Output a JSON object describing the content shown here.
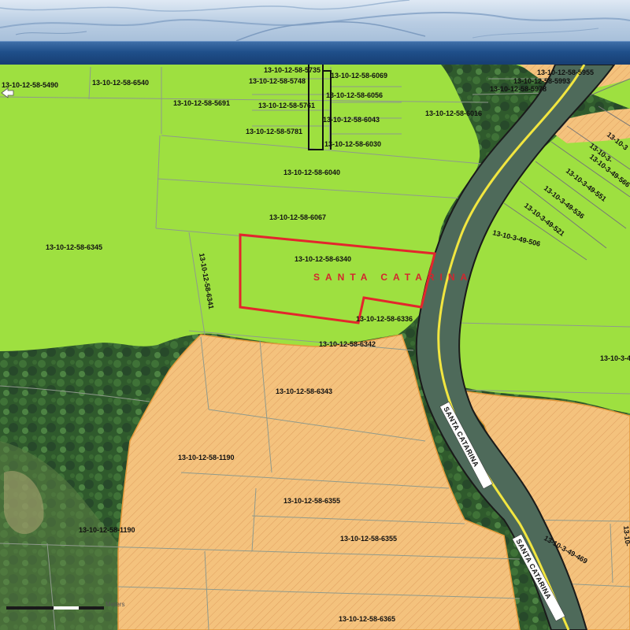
{
  "map": {
    "place_name": "SANTA CATARINA",
    "road_labels": [
      "SANTA CATARINA",
      "SANTA CATARINA"
    ],
    "scale_bar": {
      "unit_label": "Meters"
    },
    "colors": {
      "urban_zone": "#9ee040",
      "orange_zone": "#f4c27d",
      "orange_hatch": "#e0a060",
      "highlight_parcel": "#e3262c",
      "road_centerline": "#f2e640",
      "toolbar": "#1f4f8a"
    },
    "highlighted_parcel": "13-10-12-58-6340",
    "parcels": [
      "13-10-12-58-5490",
      "13-10-12-58-6540",
      "13-10-12-58-5735",
      "13-10-12-58-5748",
      "13-10-12-58-6069",
      "13-10-12-58-5955",
      "13-10-12-58-5993",
      "13-10-12-58-5978",
      "13-10-12-58-5691",
      "13-10-12-58-6056",
      "13-10-12-58-5761",
      "13-10-12-58-6016",
      "13-10-12-58-6043",
      "13-10-12-58-5781",
      "13-10-12-58-6030",
      "13-10-12-58-6040",
      "13-10-12-58-6067",
      "13-10-12-58-6345",
      "13-10-12-58-6340",
      "13-10-12-58-6341",
      "13-10-12-58-6336",
      "13-10-12-58-6342",
      "13-10-12-58-6343",
      "13-10-12-58-1190",
      "13-10-12-58-6355",
      "13-10-12-58-1190",
      "13-10-12-58-6355",
      "13-10-12-58-6365",
      "13-10-3-49-566",
      "13-10-3-49-551",
      "13-10-3-49-536",
      "13-10-3-49-521",
      "13-10-3-49-506",
      "13-10-3-49-469",
      "13-10-3",
      "13-10-3-",
      "13-10-3-4",
      "13-10-"
    ]
  }
}
